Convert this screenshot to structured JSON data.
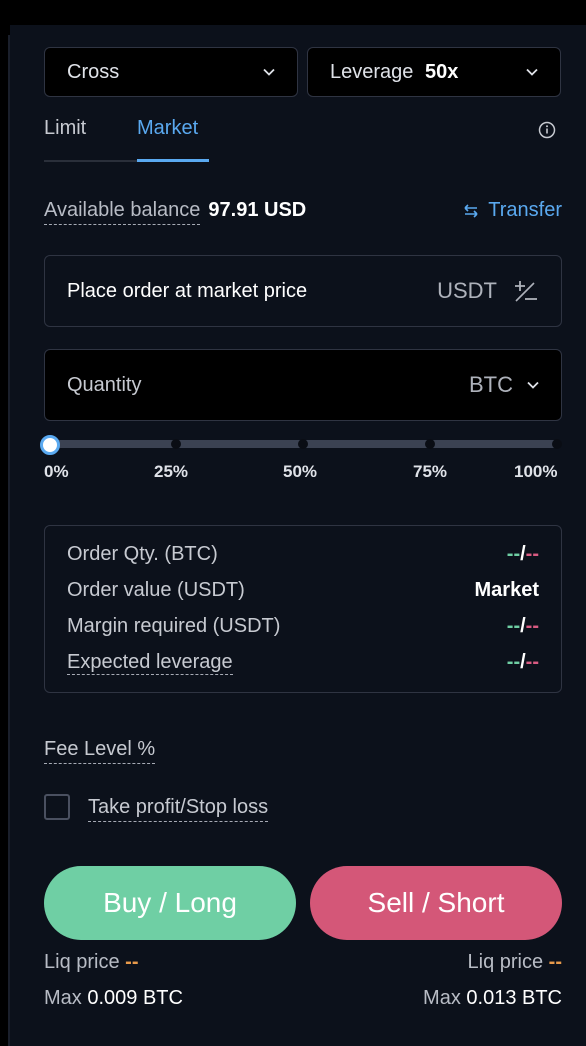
{
  "margin_mode": {
    "label": "Cross"
  },
  "leverage": {
    "label": "Leverage",
    "value": "50x"
  },
  "tabs": [
    {
      "label": "Limit"
    },
    {
      "label": "Market"
    }
  ],
  "balance": {
    "label": "Available balance",
    "value": "97.91 USD",
    "transfer_label": "Transfer"
  },
  "price_box": {
    "label": "Place order at market price",
    "unit": "USDT"
  },
  "quantity_box": {
    "label": "Quantity",
    "unit": "BTC"
  },
  "slider": {
    "value_percent": 0,
    "ticks": [
      "0%",
      "25%",
      "50%",
      "75%",
      "100%"
    ]
  },
  "summary": {
    "order_qty": {
      "label": "Order Qty. (BTC)",
      "left": "--",
      "sep": "/",
      "right": "--"
    },
    "order_value": {
      "label": "Order value (USDT)",
      "value": "Market"
    },
    "margin_required": {
      "label": "Margin required (USDT)",
      "left": "--",
      "sep": "/",
      "right": "--"
    },
    "expected_leverage": {
      "label": "Expected leverage",
      "left": "--",
      "sep": "/",
      "right": "--"
    }
  },
  "fee_level": {
    "label": "Fee Level %"
  },
  "tpsl": {
    "label": "Take profit/Stop loss",
    "checked": false
  },
  "buy": {
    "label": "Buy / Long",
    "liq_label": "Liq price",
    "liq_value": "--",
    "max_label": "Max",
    "max_value": "0.009 BTC"
  },
  "sell": {
    "label": "Sell / Short",
    "liq_label": "Liq price",
    "liq_value": "--",
    "max_label": "Max",
    "max_value": "0.013 BTC"
  },
  "colors": {
    "accent": "#5aa9f0",
    "buy": "#6fcfa4",
    "sell": "#d45778",
    "background": "#0c111b"
  }
}
